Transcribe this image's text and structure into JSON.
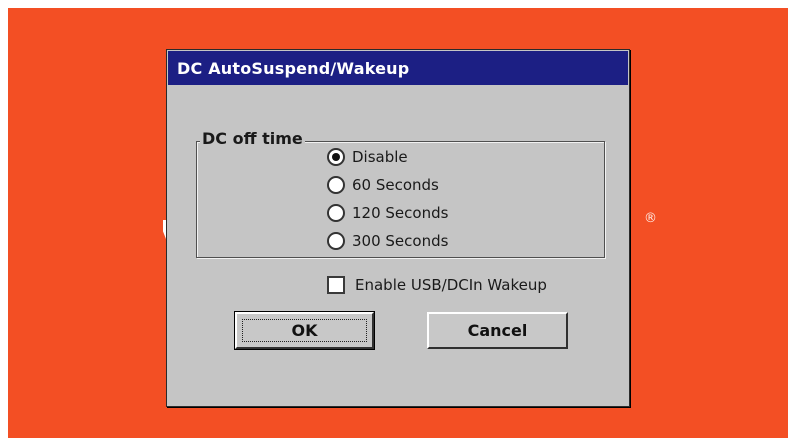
{
  "window": {
    "title": "DC AutoSuspend/Wakeup"
  },
  "background": {
    "registered_mark": "®",
    "color": "#f34f24"
  },
  "dc_off_time": {
    "label": "DC off time",
    "options": [
      {
        "label": "Disable",
        "selected": true
      },
      {
        "label": "60 Seconds",
        "selected": false
      },
      {
        "label": "120 Seconds",
        "selected": false
      },
      {
        "label": "300 Seconds",
        "selected": false
      }
    ]
  },
  "wakeup": {
    "label": "Enable USB/DCIn Wakeup",
    "checked": false
  },
  "buttons": {
    "ok_label": "OK",
    "cancel_label": "Cancel"
  },
  "colors": {
    "title_bar": "#1c1f84",
    "dialog_face": "#c5c5c5"
  }
}
